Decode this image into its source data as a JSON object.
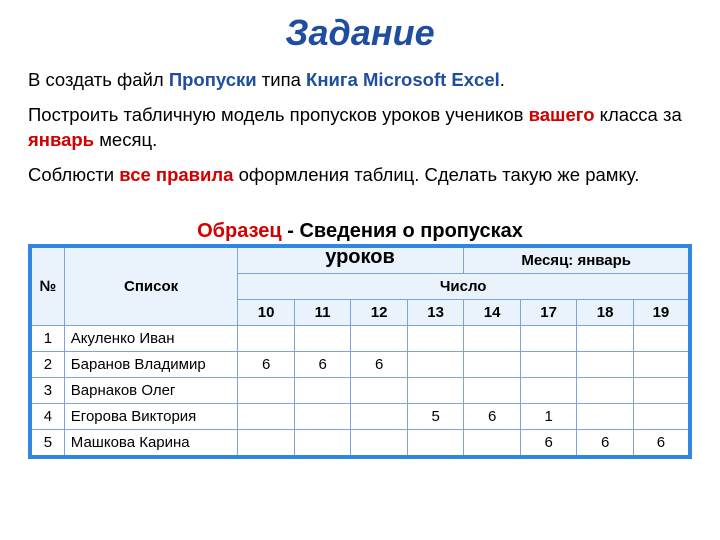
{
  "title": "Задание",
  "p1": {
    "t1": "В создать файл ",
    "b1": "Пропуски",
    "t2": " типа ",
    "b2": "Книга Microsoft Excel",
    "t3": "."
  },
  "p2": {
    "t1": "Построить табличную модель пропусков уроков учеников ",
    "b1": "вашего",
    "t2": " класса за ",
    "b2": "январь",
    "t3": " месяц."
  },
  "p3": {
    "t1": "Соблюсти ",
    "b1": "все правила",
    "t2": " оформления таблиц. Сделать такую же рамку."
  },
  "caption": {
    "red": "Образец",
    "dash": " - ",
    "black1": "Сведения о пропусках",
    "black2": "уроков"
  },
  "table": {
    "num_header": "№",
    "list_header": "Список",
    "month_label": "Месяц: январь",
    "chislo": "Число",
    "days": [
      "10",
      "11",
      "12",
      "13",
      "14",
      "17",
      "18",
      "19"
    ],
    "rows": [
      {
        "n": "1",
        "name": "Акуленко Иван",
        "v": [
          "",
          "",
          "",
          "",
          "",
          "",
          "",
          ""
        ]
      },
      {
        "n": "2",
        "name": "Баранов Владимир",
        "v": [
          "6",
          "6",
          "6",
          "",
          "",
          "",
          "",
          ""
        ]
      },
      {
        "n": "3",
        "name": "Варнаков Олег",
        "v": [
          "",
          "",
          "",
          "",
          "",
          "",
          "",
          ""
        ]
      },
      {
        "n": "4",
        "name": "Егорова Виктория",
        "v": [
          "",
          "",
          "",
          "5",
          "6",
          "1",
          "",
          ""
        ]
      },
      {
        "n": "5",
        "name": "Машкова Карина",
        "v": [
          "",
          "",
          "",
          "",
          "",
          "6",
          "6",
          "6"
        ]
      }
    ]
  }
}
